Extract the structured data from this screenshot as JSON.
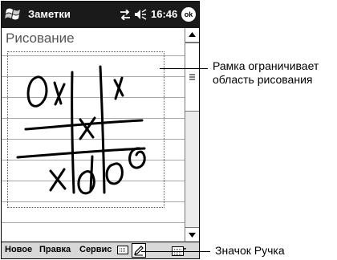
{
  "titlebar": {
    "app_title": "Заметки",
    "time": "16:46",
    "ok_label": "ok"
  },
  "note": {
    "heading": "Рисование"
  },
  "menubar": {
    "new": "Новое",
    "edit": "Правка",
    "tools": "Сервис"
  },
  "callouts": {
    "frame_line1": "Рамка ограничивает",
    "frame_line2": "область рисования",
    "pen_label": "Значок Ручка"
  },
  "icons": [
    "windows-start-icon",
    "connectivity-icon",
    "volume-icon",
    "keyboard-icon",
    "pen-icon",
    "input-panel-icon"
  ]
}
